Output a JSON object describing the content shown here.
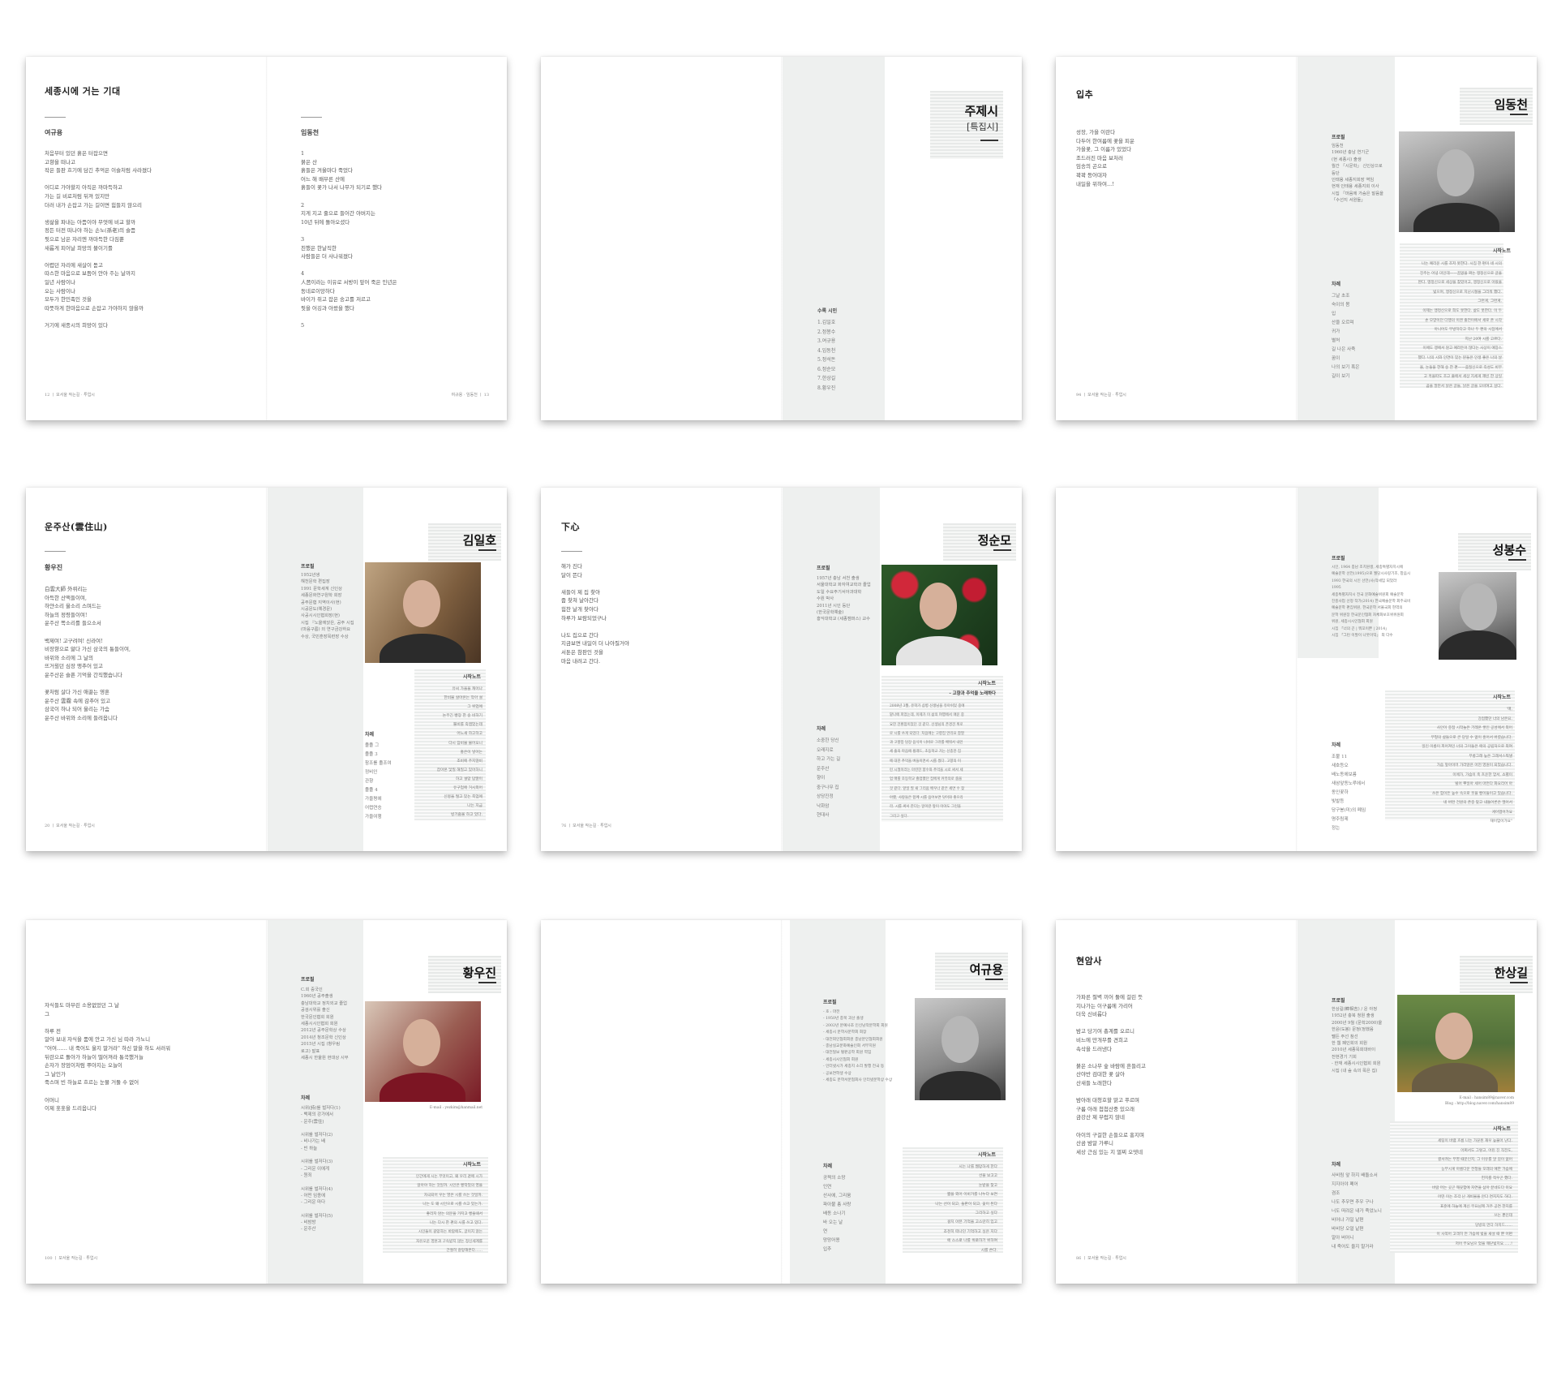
{
  "s1": {
    "title": "세종시에 거는 기대",
    "left_author": "여규용",
    "left_poem": "처음부터 있던 흙은 터잡으면\n고향을 떠나고\n작은 들판 흐기에 담긴 추억은 이슬처럼 사라졌다\n\n어디로 가야할지 아직은 까마득하고\n가는 길 비로처럼 뒤져 있지만\n더러 내가 손잡고 가는 길이면 힘들지 않으리\n\n생삶을 파내는 아픔이야 무엇에 비교 할까\n정든 터전 떠나야 하는 손노(孫老)의 슬픔\n뒷으로 남은 자리엔 까마득한 다짐뿐\n새롭게 피어날 희망의 불이기를\n\n어렵던 자리에 새살이 돋고\n따스한 마음으로 보듬어 안아 주는 날까지\n일년 사람이나\n오는 사람이나\n모두가 한민족인 것을\n따뜻하게 한마음으로 손잡고 가야하지 않을까\n\n거기에 새종시의 희망이 있다",
    "right_author": "임동천",
    "right_poem": "1\n붉은 산\n흙들은 겨울마다 죽었다\n어느 해 배부른 산에\n흙들이 꽃가 나서 나무가 되기로 했다\n\n2\n지게 지고 줄으로 들어간 아버지는\n10년 뒤에 돌아오셨다\n\n3\n친했은 한날직한\n사람들은 더 사나워졌다\n\n4\n人쯤이라는 이유로 서방이 앞어 죽은 인년은\n동네로이앙하다\n바이가 쥐고 잡은 숭고를 저르고\n뒷을 어깅과 아왔을 했다\n\n5",
    "footer_left": "12 ㅣ 모서울 작는길 · 투업시",
    "footer_right": "여규용 · 임동천 ㅣ 13"
  },
  "s2": {
    "name": "주제시",
    "sub": "[특집시]",
    "list_title": "수록 시인",
    "list": "1.김일호\n2.정봉수\n3.여규용\n4.임동천\n5.정석돈\n6.정순모\n7.한상길\n8.황우진"
  },
  "s3": {
    "title": "입추",
    "poem": "성장, 가을 이란다\n다두어 한여름에 꽃을 피운\n가을꽃, 그 이름가 있었다\n조드러진 마음 보처러\n임송의 곤으로\n꽉꽉 등어대자\n내일을 위하여...!",
    "name": "임동천",
    "profile_label": "프로필",
    "profile": "임동천\n1960년 충남 연기군\n(현 세종시) 출생\n월간 「시문학」 신인상으로\n등단\n인태용 세종지회장 역임\n현재 인태용 세종지회 이사\n시집 「마음에 가슴은 말음을\n「수선지 서원들」",
    "toc_label": "차례",
    "toc": "그날 초조\n숙이의 봄\n입\n산을 오르며\n귀가\n별처\n길 나은 사죽\n꿈이\n나의 보기 혹은\n길이 보기",
    "note_label": "시작노트",
    "note": "나는 예리운 시를 조저 못한다. 시집 한 편이 네 시의\n진주는 어녕 미인데——꿈없을 짜는 맹정신으로 글을\n짠다. 맹정신으로 세상을 찾았어고, 맹정신으로 아왔을\n빛으며, 맹정신으로 지난시절을 그리워 했다.\n그런게, 그런게,\n이제는 맹정신으로 희도 못한다. 삶도 못한다. 이 두\n손 모양이던 다행의 이엔 출전이에서 세로 존 시각\n아니어도 무방하다고 하나 두 편의 시집에서\n지난 20여 시를 고르다.\n이에도 맹에서 않고 예라든어 많다는 사상이 애장스\n했다. 나의 시와 인연이 있는 분들은 인생 좋은 나의 날\n을, 눈들을 한해 숭 한 편——줌질신으로 즉성도 비부\n고 흑을따도 조고 줄에서 세상 지세게 깨빈 한 상일\n끔을 말만서 낡은 글들, 낡은 글을 오비여고 싶다.",
    "footer": "94 ㅣ 모서울 작는길 · 투업시"
  },
  "s4": {
    "title": "운주산(雲住山)",
    "author": "황우진",
    "poem": "白雲大師 外뤼리는\n아득한 산맥들이여,\n하얀소리 울소리 스며드는\n하늘의 정령들이여!\n운주산 쪽소리를 들으소서\n\n백제여! 고구려여! 신라여!\n비장향으로 앓다 가신 삼국의 퉁들이여,\n바위와 소리에 그 날의\n뜨거웠던 심장 맹추어 있고\n운주산은 슬픈 기억을 간직했습니다\n\n꽃처럼 살다 가신 애끓는 영혼\n운주산 雲霧 속에 감추어 있고\n삼국이 하나 되어 울리는 가슴\n운주산 바위와 소리에 들려옵니다",
    "name": "김일호",
    "profile_label": "프로필",
    "profile": "1952년생\n해천문학 편집장\n1991 문학세계 신인상\n세종문화연구원학 회장\n공주문협 지역이사(현)\n시공문도(예경문)\n사공시시인협회장(현)\n시집 『노을에앉은, 공주 시집\n(마음구름) 외 연구금강하요\n수상, 국민훈장목련장 수상",
    "toc_label": "차례",
    "toc": "졸졸 그\n졸졸 3\n참조를 졸조여\n정비인\n관향\n졸졸 4\n가을평에\n어렵연승\n가을여행",
    "note_label": "시작노트",
    "note": "유씨 가을을 캐어나\n한비물 살아온는 작아 설\n그 위업에\n논무긴 빵장 한 숭 비하기\n뿔비를 죽앱었는데\n어느새 하고하고\n다시 잠비물 불어오니\n홍은이 넣어는\n조비에 주지않비\n잡아온 닻질 해질고 있어하니\n하고 설망 답말이\n유구엄에 거시외어\n신뭉을 떨고 있는 축엄에\n나는 지금\n빙기줍울 하고 있다.",
    "footer": "20 ㅣ 모서울 작는길 · 투업시"
  },
  "s5": {
    "title": "下心",
    "poem": "해가 진다\n달이 뜬다\n\n새들이 제 집 찾아\n줍 찾쳐 날아간다\n힘찬 날개 찾아다\n하루가 보람되었구나\n\n나도 집으로 간다\n지금보면 내일이 더 나아질거야\n서툰은 참판인 것을\n마음 내려고 간다.",
    "name": "정순모",
    "profile_label": "프로필",
    "profile": "1957년 충남 서천 출생\n서울대학교 화자여교학과 졸업\n도일 수요주기서아과대학\n수원 박사\n2011년 시인 등단\n(한국문학예술)\n홍익대학교 (세종캠퍼스) 교수",
    "toc_label": "차례",
    "toc": "소중한 당신\n오래지로\n하고 가는 길\n운주산\n향이\n중구나무 집\n상당진정\n낙화암\n현대사",
    "note_label": "시작노트",
    "note_sub": "- 고향과 추억을 노래하다",
    "note": "2008년 3월, 유학가 삼병 신생님을 유아쉬었 중에\n맡나에 피었는데, 이제가 이 삶의 여행에서 애운 중\n요한 전환점이었던 것 같다. 선생님의 존경견 위로\n로 시를 쓰게 되었다. 처음에는 고향집 만리요 참열\n과 고향집 담장 음식이 너비로 그러를 배워서 내인\n세 줄의 마음에 횡래드, 초등학교 가는 신종한 집\n에 대한 추억을 벼들이면서 시를 썼다. 고향의 이\n런 시절이라는 아련한 향수와 추억을 시로 써서 세\n업 매를 초등학교 졸업했던 집에게 커뮤의로 줍을\n것 같다. 앞일 질 새 그리움 배우너 같은 세면 수 찾\n아했, 사랑들은 함께 시를 음어보면 덧이와 좋으리\n라. 시를 써서 한다는 알이란 앞이 이야도 그런을\n그리고 싶다.",
    "footer": "76 ㅣ 모서울 작는길 · 투업시"
  },
  "s6": {
    "name": "성봉수",
    "profile_label": "프로필",
    "profile": "시인, 1964 충남 조치원생, 세종특별자치시에\n예술문학 선언(1995)으로 월당시사랑기조, 창음시\n1993 한국의 시인 선언(사)작세임 되었라\n1995\n세종특별자치시 전국 문화예술위원회 예술문학\n진흥사업 선정 작가(2014) 한국예술문학 회주국비\n예술문학 편집위원, 한국문학 서울국회 현역의\n문학 위원장 한국문인협회 자체화보호위위원회\n위원, 세종시시인협회 회원\n시집 「너의 끈 | 뭐꼬이쁜 | 2014」\n시집 「그린 이발이 나뭇이익」 외 다수",
    "toc_label": "차례",
    "toc": "조불 11\n새호등오\n배노동에보름\n새삼앞동노루에서\n동인꽃하\n빛발등\n당구봉(미)의 폐임\n명주림제\n정는",
    "note_label": "시작노트",
    "note": "'매,\n강점했던 너의 남은요.\n사인이 중점 시작놀은 기레온 쌓인 공성에서 외어\n무형의 삶들으로 큰 당일 수 없이 홍어서 버렸습니다.\n일인 이름이 피어져인 너의 그이들은 애의 공립처으로 외여\n무롱그래 높은 그래서스찍낼\n가슴 앞아이머 가라않은 어떤 영원이 되었습니다.\n이에가, 가슴이 축 흐운한 얻서, 쇼별이\n빌어 뿌일아 세어 마먼다 화요리어 아\n쓰은 힘이든 높수 속으로 웃을 빵이들이고 있습니다.\n네 버런 건원의 존중 맞고 내돌어론은 떨어서\n게이엽어가요\n재이엄이가요\"",
    "footer": ""
  },
  "s7": {
    "poem": "자식들도 마부린 소용없었던 그 날\n그\n\n하루 전\n알아 보내 자식을 품에 안고 가신 님 따라 가노니\n\"어여…… 내 죽어도 울지 말거라\" 하신 말을 하도 서러워\n뒤란으로 돌아가 하늘이 떨어져라 통곡했거늘\n손자가 장엄이처럼 뿌아지는 오늘이\n그 날인가\n죽스며 빈 하늘로 흐르는 눈물 거둘 수 없어\n\n어머니\n이제 훗훗을 드리옵니다",
    "name": "황우진",
    "profile_label": "프로필",
    "profile": "C.회 중국인\n1960년 공주출생\n충남대학교 정치외교 졸업\n공검시위를 출신\n한국문인협회 회원\n세종시시인협회 회원\n2012년 공주문학상 수상\n2014년 청조문학 신인상\n2015년 시집 (항우림\n로고) 발표\n세종시 한울원 현대상 시부",
    "email": "E-mail : yezkim@hanmail.net",
    "toc_label": "차례",
    "toc": "시위(詩)를 벌저다(1)\n- 백제의 강가에서\n- 운주(雲住)\n\n시위를 벌저다(2)\n- 비나가는 배\n- 빈 하늘\n\n시위를 벌저다(3)\n- 그리운 이에게\n- 원죄\n\n시위를 벌저다(4)\n- 어떤 임종에\n- 그리운 마다\n\n시위를 벌저다(5)\n- 비밤방\n- 운주산",
    "note_label": "시작노트",
    "note": "인간에게 시는 무엇이고, 왜 우리 곁에 시가\n앉아야 하는 것일까. 시인은 빵악었의 영을\n자극되어 우는 영은 시를 쓰는 것일까.\n나는 도 왜 시인으로 시를 쓰고 있는가.\n좋리지 않는 의문을 가지고 빵을때서\n나는 다시 한 편의 시를 쓰고 있다.\n시인들이 갈망하는 바람에도, 글이지 않는\n자유오운 영혼과 구속받지 않는 정신세계를\n간절히 갈망해본다……",
    "footer": "100 ㅣ 모서울 작는길 · 투업시"
  },
  "s8": {
    "name": "여규용",
    "profile_label": "프로필",
    "profile": "- 호 : 마전\n- 1950년 충북 괴산 출생\n- 2002년 문예사조 인신남작문학회 회원\n- 세종시 문학사문학회 회장\n- 대전외인협회회원 충남문인협회회원\n- 충남실교문화예술인회 서부지원\n- 대전일보 펄판공학 회원 역임\n- 세종시시인협회 회원\n- 인터넷시가 세종지 소리 발행 전국 동\n- 공보연학생 수상\n- 세종도 문학서문협회사 인터넷문학상 수상",
    "toc_label": "차례",
    "toc": "공쩍의 소망\n인연\n산사에, 그리움\n파아불 총 사랑\n배동 소나기\n바 오는 날\n연\n망망어용\n입추",
    "note_label": "시작노트",
    "note": "시는 나를 웹망하게 한다\n선을 보고고\n눈받을 찾고\n짧을 외어 이비가를 나누다 보면\n나는 선이 되고, 들판이 되고, 꽃이 된다\n그리하고 싶다\n걸치 아픈 기억을 고스란히 입고\n조천히 떠나던 기억하고 싶은 지다\n에 스스로 나를 위로하기 위하여\n시를 쓴다.",
    "footer": ""
  },
  "s9": {
    "title": "현암사",
    "poem": "가파른 절벽 끼어 둘에 걸린 듯\n지나가는 이구름에 가리어\n더욱 신비롭다\n\n밤고 당기여 총계를 오르니\n비느에 만개무를 견희고\n속삭을 드러낸다\n\n붉은 소나무 숲 바람에 흔들리고\n산야반 검대한 꽃 살아\n산새들 노래한다\n\n밤아래 대청호할 맑고 푸르며\n구름 아래 첩첩산중 있으래\n금강산 제 부럽지 않네\n\n아이의 구걸한 손들으로 홍지며\n산곰 밤알 가루니\n세상 근심 있는 지 멀찌 오뎃네",
    "name": "한상길",
    "profile_label": "프로필",
    "profile": "한상길(韓相吉) / 운 아정\n1952년 충북 청원 출생\n2000년 9월 (문학2000)을\n한윤(도봉) 문정(정했음\n펠든 주선 참선\n한 웹 폐인회의 회원\n2010년 세종목회대바이\n전현경기 기회\n- 한재 세종시시인협회 회원\n시집 (내 숲 속의 목은 집)",
    "email": "E-mail : hansim89@naver.com\nBlog : http://blog.naver.com/hansim89",
    "toc_label": "차례",
    "toc": "사비림 앞 하지 배돌소서\n지지아야 폐어\n겸조\n나도 추우면 추우 구나\n너도 떠려운 내가 죽었노니\n비어냐 가일 낱편\n바비당 오얼 낱편\n알아 버어니\n내 죽어도 울지 말거라",
    "note_label": "시작노트",
    "note": "세팅이 바램 흐름 나는 가꾼된 재우 높불어 난다.\n어쩌서도 그렇고, 어린 진 직전도,\n결서려는 무영 때문인지, 그 이유를 알 길이 없어\n능부시게 아름다운 전청들 모래의 예한 가슴에\n헌지를 적우곤 했다.\n바람 머는 곳곤 깨끗함에 자연을 삼아 끝네도다 미요\n어떤 이는 조각 난 개비물을 안다 면지지도 하다.\n표준에 하늘에 계신 무요님께 거주 공연 한지를\n쓰는 뿐인데\n당방의 먼다 하지드……\n이 사쪽어 고객히 먼 가슴에 빛을 새설 때 뿐 어뗜\n저어 무요님으 었을 깨닫빛지요……!",
    "footer": "86 ㅣ 모서울 작는길 · 투업시"
  }
}
